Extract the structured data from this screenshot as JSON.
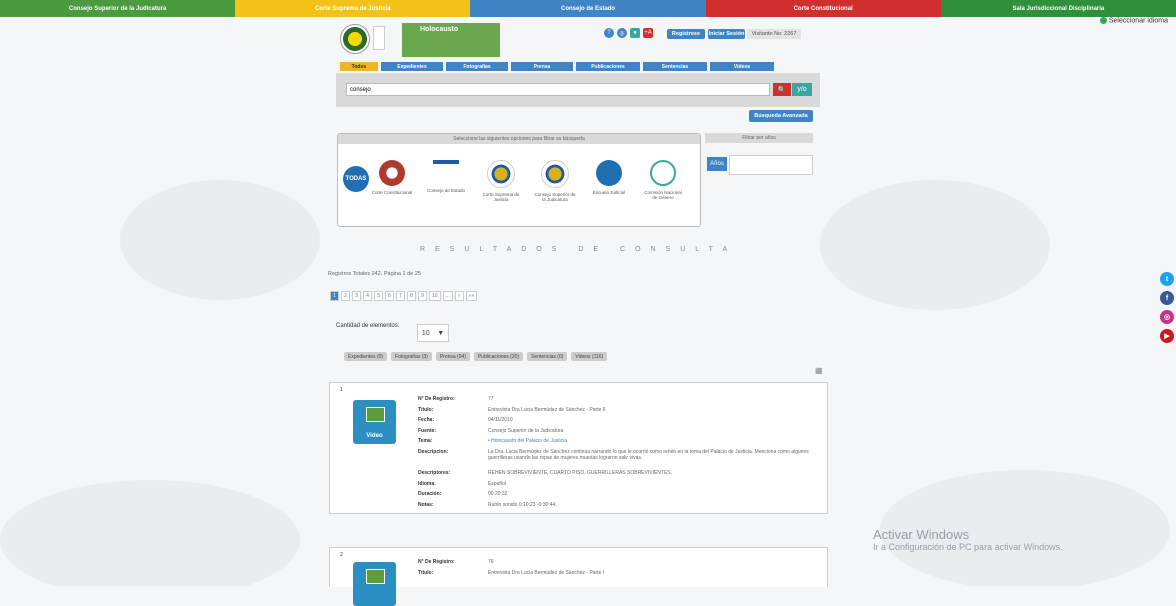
{
  "topbar": [
    {
      "label": "Consejo Superior de la Judicatura",
      "color": "#4a9b3e"
    },
    {
      "label": "Corte Suprema de Justicia",
      "color": "#f2c316"
    },
    {
      "label": "Consejo de Estado",
      "color": "#3f85c6"
    },
    {
      "label": "Corte Constitucional",
      "color": "#d12e2e"
    },
    {
      "label": "Sala Jurisdiccional Disciplinaria",
      "color": "#2f8f3a"
    }
  ],
  "language": "Seleccionar idioma",
  "header": {
    "brand": "Holocausto",
    "register": "Registrese",
    "login": "Iniciar Sesión",
    "visitors": "Visitante No: 2267"
  },
  "tabs": [
    "Todos",
    "Expedientes",
    "Fotografías",
    "Prensa",
    "Publicaciones",
    "Sentencias",
    "Videos"
  ],
  "search": {
    "value": "consejo",
    "button_search": "🔍",
    "button_and": "y/o",
    "advanced": "Búsqueda Avanzada"
  },
  "filter": {
    "title": "Seleccione las siguientes opciones para filtrar su búsqueda",
    "all": "TODAS",
    "institutions": [
      {
        "label": "Corte Constitucional",
        "color": "#b03a2e"
      },
      {
        "label": "Consejo de Estado",
        "color": "#1f5aa8"
      },
      {
        "label": "Corte Suprema de Justicia",
        "color": "#d6b11a"
      },
      {
        "label": "Consejo Superior de la Judicatura",
        "color": "#d6b11a"
      },
      {
        "label": "Escuela Judicial",
        "color": "#1f6fb2"
      },
      {
        "label": "Comisión Nacional de Género",
        "color": "#3aa6a0"
      }
    ]
  },
  "years": {
    "title": "Filtrar por años",
    "button": "Años"
  },
  "results": {
    "title": "RESULTADOS DE CONSULTA",
    "summary": "Registros Totales 242, Página 1 de 25",
    "pages": [
      "1",
      "2",
      "3",
      "4",
      "5",
      "6",
      "7",
      "8",
      "9",
      "10",
      "...",
      "»",
      "»»"
    ],
    "quantity_label": "Cantidad de elementos:",
    "quantity_value": "10",
    "filter_tabs": [
      "Expedientes (0)",
      "Fotografías (3)",
      "Prensa (94)",
      "Publicaciones (20)",
      "Sentencias (0)",
      "Videos (116)"
    ]
  },
  "records": [
    {
      "index": "1",
      "type": "Video",
      "fields": [
        {
          "k": "N° De Registro:",
          "v": "77"
        },
        {
          "k": "Título:",
          "v": "Entrevista Dra Lucia Bermúdez de Sánchez - Parte II"
        },
        {
          "k": "Fecha:",
          "v": "04/11/2010"
        },
        {
          "k": "Fuente:",
          "v": "Consejo Superior de la Judicatura"
        },
        {
          "k": "Tema:",
          "v": "• Holocausto del Palacio de Justicia",
          "link": true
        },
        {
          "k": "Descripcion:",
          "v": "La Dra. Lucia Bermúdez de Sánchez continúa narrando lo que le ocurrió como rehén en la toma del Palacio de Justicia. Menciona como algunos guerrilleras usando las ropas de mujeres muertas lograron salir vivas."
        },
        {
          "k": "Descriptores:",
          "v": "REHÉN SOBREVIVIENTE, CUARTO PISO, GUERRILLERAS SOBREVIVIENTES."
        },
        {
          "k": "Idioma:",
          "v": "Español"
        },
        {
          "k": "Duración:",
          "v": "00:20:32"
        },
        {
          "k": "Notas:",
          "v": "Rutón sonido 0:10:23 -0:30:44."
        }
      ]
    },
    {
      "index": "2",
      "type": "Video",
      "fields": [
        {
          "k": "N° De Registro:",
          "v": "76"
        },
        {
          "k": "Título:",
          "v": "Entrevista Dra Lucia Bermúdez de Sánchez - Parte I"
        }
      ]
    }
  ],
  "windows": {
    "line1": "Activar Windows",
    "line2": "Ir a Configuración de PC para activar Windows."
  },
  "social": [
    {
      "name": "twitter",
      "color": "#1da1f2",
      "glyph": "t"
    },
    {
      "name": "facebook",
      "color": "#3b5998",
      "glyph": "f"
    },
    {
      "name": "instagram",
      "color": "#c13584",
      "glyph": "◎"
    },
    {
      "name": "youtube",
      "color": "#cc181e",
      "glyph": "▶"
    }
  ]
}
